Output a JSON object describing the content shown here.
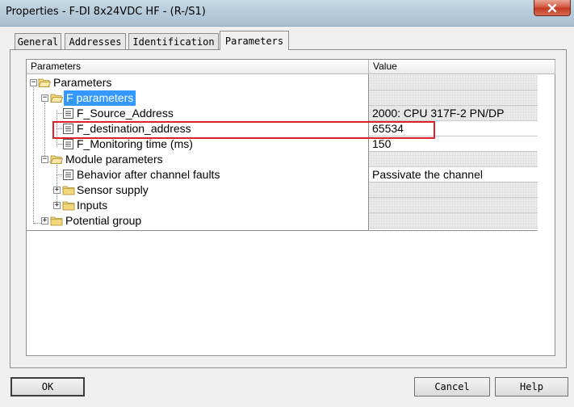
{
  "window": {
    "title": "Properties - F-DI 8x24VDC HF - (R-/S1)",
    "close_icon": "close-icon"
  },
  "tabs": [
    {
      "label": "General",
      "active": false
    },
    {
      "label": "Addresses",
      "active": false
    },
    {
      "label": "Identification",
      "active": false
    },
    {
      "label": "Parameters",
      "active": true
    }
  ],
  "grid": {
    "columns": [
      "Parameters",
      "Value"
    ],
    "rows": [
      {
        "label": "Parameters",
        "value": "",
        "value_editable": false
      },
      {
        "label": "F parameters",
        "value": "",
        "value_editable": false,
        "selected": true
      },
      {
        "label": "F_Source_Address",
        "value": "2000: CPU 317F-2 PN/DP",
        "value_editable": false
      },
      {
        "label": "F_destination_address",
        "value": "65534",
        "value_editable": true,
        "highlighted": true
      },
      {
        "label": "F_Monitoring time (ms)",
        "value": "150",
        "value_editable": true
      },
      {
        "label": "Module parameters",
        "value": "",
        "value_editable": false
      },
      {
        "label": "Behavior after channel faults",
        "value": "Passivate the channel",
        "value_editable": true
      },
      {
        "label": "Sensor supply",
        "value": "",
        "value_editable": false
      },
      {
        "label": "Inputs",
        "value": "",
        "value_editable": false
      },
      {
        "label": "Potential group",
        "value": "",
        "value_editable": false
      }
    ]
  },
  "buttons": {
    "ok": "OK",
    "cancel": "Cancel",
    "help": "Help"
  },
  "colors": {
    "selection": "#3399ff",
    "highlight_box": "#e0202a"
  }
}
